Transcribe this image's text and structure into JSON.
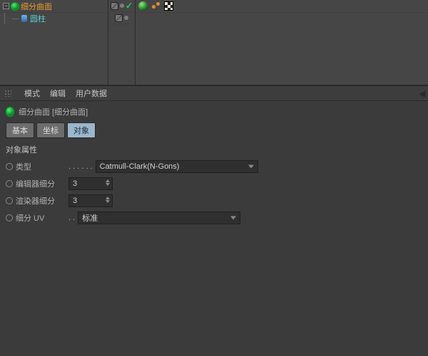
{
  "tree": {
    "parent_name": "细分曲面",
    "child_name": "圆柱"
  },
  "menubar": {
    "mode": "模式",
    "edit": "编辑",
    "userdata": "用户数据"
  },
  "attr": {
    "title": "细分曲面 [细分曲面]",
    "tabs": {
      "basic": "基本",
      "coord": "坐标",
      "object": "对象"
    },
    "group": "对象属性",
    "fields": {
      "type_label": "类型",
      "type_value": "Catmull-Clark(N-Gons)",
      "editor_label": "编辑器细分",
      "editor_value": "3",
      "render_label": "渲染器细分",
      "render_value": "3",
      "subdivuv_label": "细分 UV",
      "subdivuv_value": "标准"
    }
  }
}
